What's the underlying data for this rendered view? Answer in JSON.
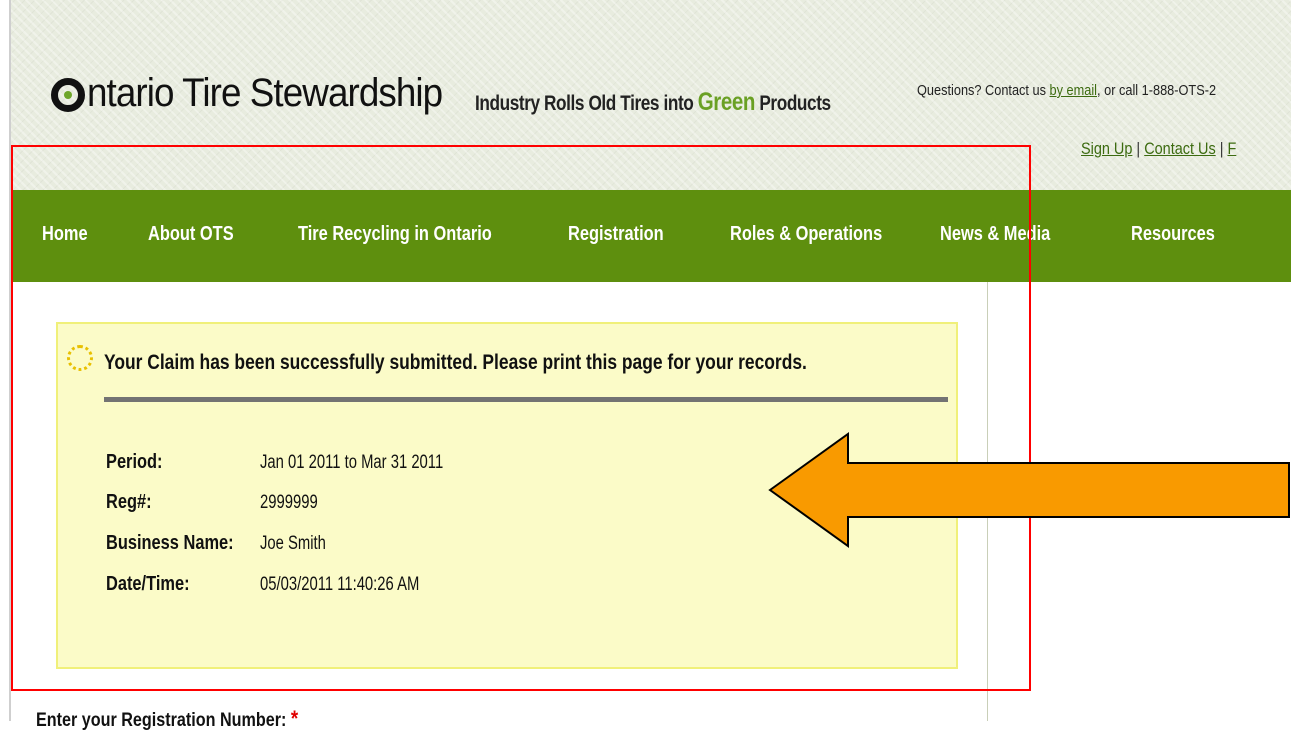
{
  "header": {
    "logo_text": "ntario Tire Stewardship",
    "tagline_pre": "Industry Rolls Old Tires into ",
    "tagline_green": "Green",
    "tagline_post": " Products",
    "contact_pre": "Questions? Contact us ",
    "contact_link": "by email",
    "contact_post": ", or call 1-888-OTS-2",
    "util_links": [
      "Sign Up",
      "Contact Us",
      "F"
    ]
  },
  "nav": {
    "items": [
      "Home",
      "About OTS",
      "Tire Recycling in Ontario",
      "Registration",
      "Roles & Operations",
      "News & Media",
      "Resources"
    ]
  },
  "notice": {
    "message": "Your Claim has been successfully submitted. Please print this page for your records.",
    "fields": [
      {
        "label": "Period:",
        "value": "Jan 01 2011 to Mar 31 2011"
      },
      {
        "label": "Reg#:",
        "value": "2999999"
      },
      {
        "label": "Business Name:",
        "value": "Joe Smith"
      },
      {
        "label": "Date/Time:",
        "value": "05/03/2011 11:40:26 AM"
      }
    ]
  },
  "form": {
    "reg_label": "Enter your Registration Number:",
    "required_mark": "*"
  },
  "colors": {
    "nav_green": "#5e8f0e",
    "notice_bg": "#fbfbc8",
    "highlight_box": "#ff0000",
    "arrow": "#f99a00"
  },
  "icons": [
    "logo-o-icon",
    "notice-info-icon",
    "orange-arrow-annotation"
  ]
}
